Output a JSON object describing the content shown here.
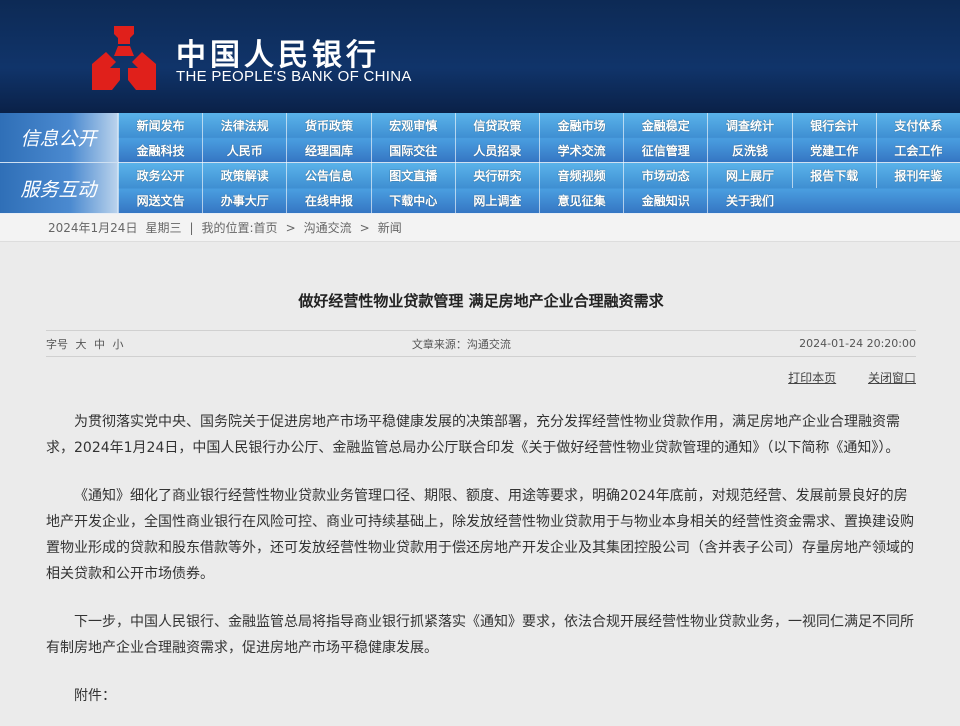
{
  "header": {
    "brand_cn": "中国人民银行",
    "brand_en": "THE PEOPLE'S BANK OF CHINA",
    "logo_color": "#e0201b"
  },
  "nav": {
    "blocks": [
      {
        "label": "信息公开",
        "rows": [
          [
            "新闻发布",
            "法律法规",
            "货币政策",
            "宏观审慎",
            "信贷政策",
            "金融市场",
            "金融稳定",
            "调查统计",
            "银行会计",
            "支付体系"
          ],
          [
            "金融科技",
            "人民币",
            "经理国库",
            "国际交往",
            "人员招录",
            "学术交流",
            "征信管理",
            "反洗钱",
            "党建工作",
            "工会工作"
          ]
        ]
      },
      {
        "label": "服务互动",
        "rows": [
          [
            "政务公开",
            "政策解读",
            "公告信息",
            "图文直播",
            "央行研究",
            "音频视频",
            "市场动态",
            "网上展厅",
            "报告下载",
            "报刊年鉴"
          ],
          [
            "网送文告",
            "办事大厅",
            "在线申报",
            "下载中心",
            "网上调查",
            "意见征集",
            "金融知识",
            "关于我们"
          ]
        ]
      }
    ]
  },
  "breadcrumb": {
    "date": "2024年1月24日",
    "weekday": "星期三",
    "sep": "|",
    "location": "我的位置:首页",
    "arrow": ">",
    "item1": "沟通交流",
    "item2": "新闻"
  },
  "article": {
    "title": "做好经营性物业贷款管理 满足房地产企业合理融资需求",
    "font_size_label": "字号",
    "font_large": "大",
    "font_medium": "中",
    "font_small": "小",
    "source": "文章来源：沟通交流",
    "datetime": "2024-01-24 20:20:00",
    "print": "打印本页",
    "close": "关闭窗口",
    "paragraphs": [
      "为贯彻落实党中央、国务院关于促进房地产市场平稳健康发展的决策部署，充分发挥经营性物业贷款作用，满足房地产企业合理融资需求，2024年1月24日，中国人民银行办公厅、金融监管总局办公厅联合印发《关于做好经营性物业贷款管理的通知》（以下简称《通知》）。",
      "《通知》细化了商业银行经营性物业贷款业务管理口径、期限、额度、用途等要求，明确2024年底前，对规范经营、发展前景良好的房地产开发企业，全国性商业银行在风险可控、商业可持续基础上，除发放经营性物业贷款用于与物业本身相关的经营性资金需求、置换建设购置物业形成的贷款和股东借款等外，还可发放经营性物业贷款用于偿还房地产开发企业及其集团控股公司（含并表子公司）存量房地产领域的相关贷款和公开市场债券。",
      "下一步，中国人民银行、金融监管总局将指导商业银行抓紧落实《通知》要求，依法合规开展经营性物业贷款业务，一视同仁满足不同所有制房地产企业合理融资需求，促进房地产市场平稳健康发展。",
      "附件："
    ]
  }
}
